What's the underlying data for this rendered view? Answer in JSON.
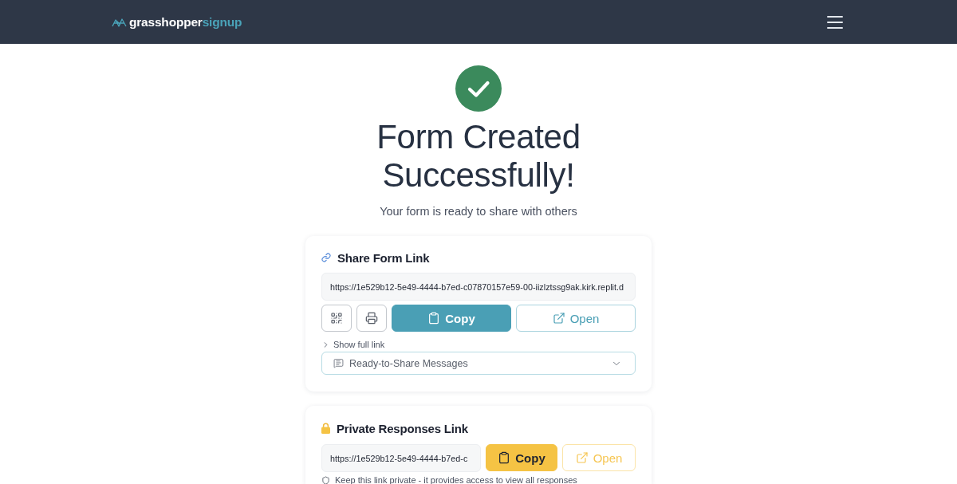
{
  "header": {
    "logo": {
      "primary": "grasshopper",
      "accent": "signup"
    }
  },
  "hero": {
    "title": "Form Created Successfully!",
    "subtitle": "Your form is ready to share with others"
  },
  "cards": [
    {
      "kind": "share",
      "title": "Share Form Link",
      "url": "https://1e529b12-5e49-4444-b7ed-c07870157e59-00-iizlztssg9ak.kirk.replit.d",
      "buttons": [
        {
          "kind": "qr"
        },
        {
          "kind": "print"
        },
        {
          "kind": "copy",
          "label": "Copy"
        },
        {
          "kind": "open",
          "label": "Open"
        }
      ],
      "toggle": {
        "label": "Show full link",
        "expanded": false
      },
      "dropdown": {
        "label": "Ready-to-Share Messages",
        "expanded": false
      }
    },
    {
      "kind": "private",
      "title": "Private Responses Link",
      "url": "https://1e529b12-5e49-4444-b7ed-c",
      "buttons": [
        {
          "kind": "copy",
          "label": "Copy"
        },
        {
          "kind": "open",
          "label": "Open"
        }
      ],
      "note": "Keep this link private - it provides access to view all responses"
    }
  ]
}
